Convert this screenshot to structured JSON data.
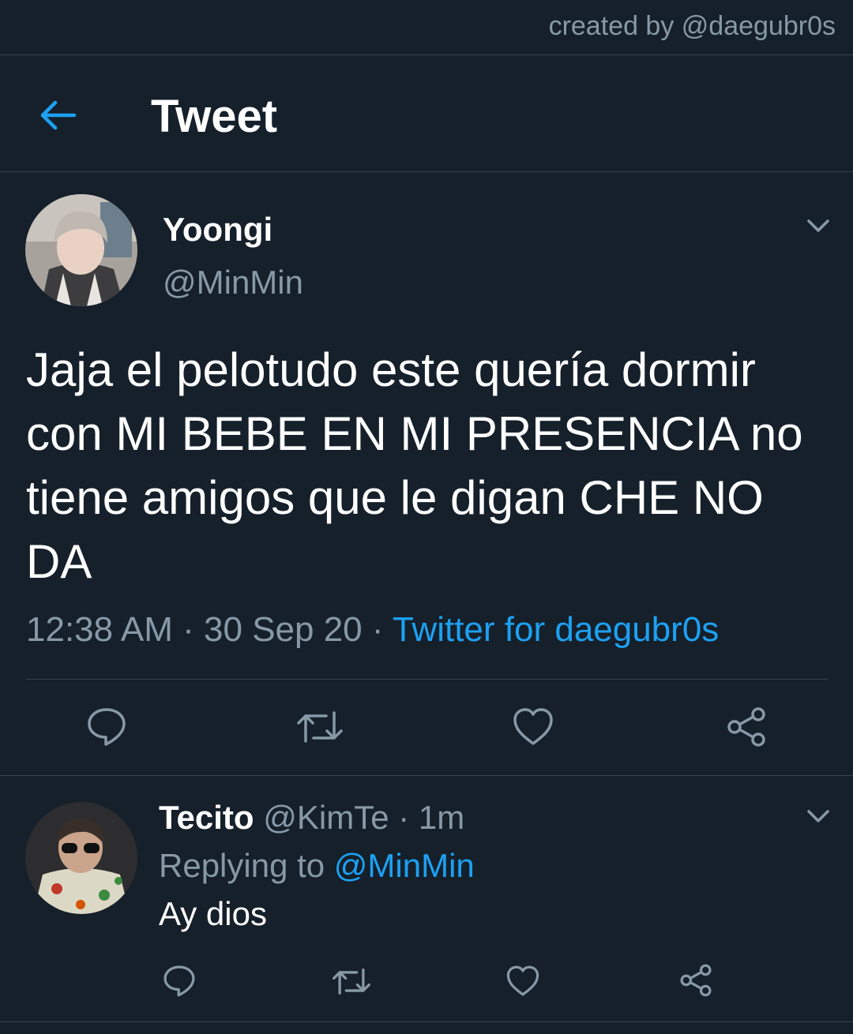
{
  "credit": "created by @daegubr0s",
  "header": {
    "title": "Tweet",
    "back_icon": "arrow-left-icon"
  },
  "colors": {
    "background": "#15202b",
    "accent": "#1da1f2",
    "secondary_text": "#8899a6",
    "divider": "#38444d"
  },
  "tweet": {
    "author_name": "Yoongi",
    "author_handle": "@MinMin",
    "text_lines": [
      "Jaja el pelotudo este quería dormir",
      "con MI BEBE EN MI PRESENCIA no",
      "tiene amigos que le digan CHE NO",
      "DA"
    ],
    "time": "12:38 AM",
    "separator": "·",
    "date": "30 Sep 20",
    "source": "Twitter for daegubr0s",
    "actions": [
      "reply-icon",
      "retweet-icon",
      "like-icon",
      "share-icon"
    ]
  },
  "reply": {
    "author_name": "Tecito",
    "author_handle": "@KimTe",
    "separator": "·",
    "time_ago": "1m",
    "replying_prefix": "Replying to",
    "replying_to": "@MinMin",
    "text": "Ay dios",
    "actions": [
      "reply-icon",
      "retweet-icon",
      "like-icon",
      "share-icon"
    ]
  }
}
